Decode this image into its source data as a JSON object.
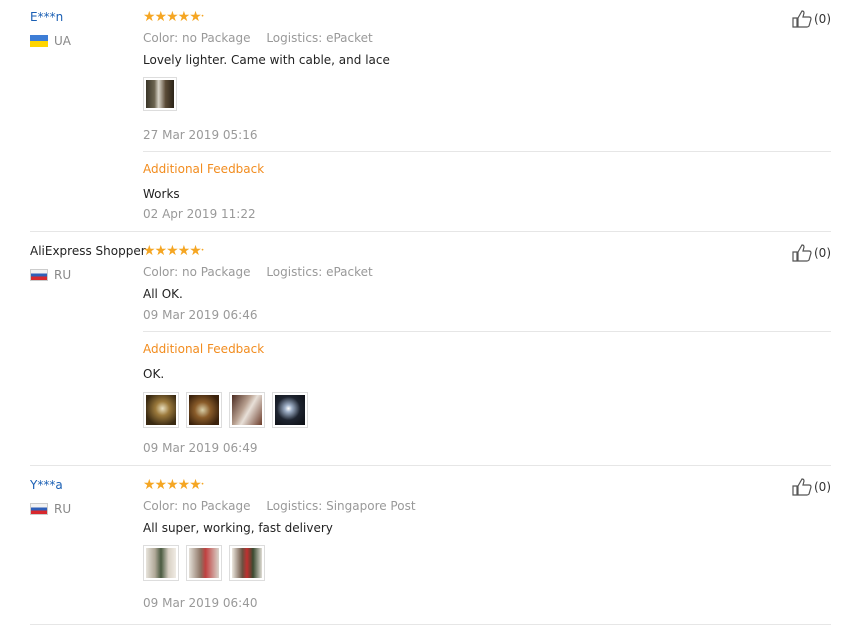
{
  "reviews": [
    {
      "user": "E***n",
      "country": "UA",
      "stars": "★★★★★",
      "color": "Color: no Package",
      "logistics": "Logistics: ePacket",
      "text": "Lovely lighter. Came with cable, and lace",
      "date": "27 Mar 2019 05:16",
      "additional_label": "Additional Feedback",
      "additional_text": "Works",
      "additional_date": "02 Apr 2019 11:22",
      "votes": "(0)"
    },
    {
      "user": "AliExpress Shopper",
      "country": "RU",
      "stars": "★★★★★",
      "color": "Color: no Package",
      "logistics": "Logistics: ePacket",
      "text": "All OK.",
      "date": "09 Mar 2019 06:46",
      "additional_label": "Additional Feedback",
      "additional_text": "OK.",
      "additional_date": "09 Mar 2019 06:49",
      "votes": "(0)"
    },
    {
      "user": "Y***a",
      "country": "RU",
      "stars": "★★★★★",
      "color": "Color: no Package",
      "logistics": "Logistics: Singapore Post",
      "text": "All super, working, fast delivery",
      "date": "09 Mar 2019 06:40",
      "votes": "(0)"
    }
  ],
  "icons": {
    "thumb": "thumbs-up-icon",
    "flag_ua": "flag-ua-icon",
    "flag_ru": "flag-ru-icon"
  },
  "colors": {
    "link": "#1a5fb4",
    "star": "#f5a623",
    "additional": "#f28c1e",
    "muted": "#999999"
  }
}
